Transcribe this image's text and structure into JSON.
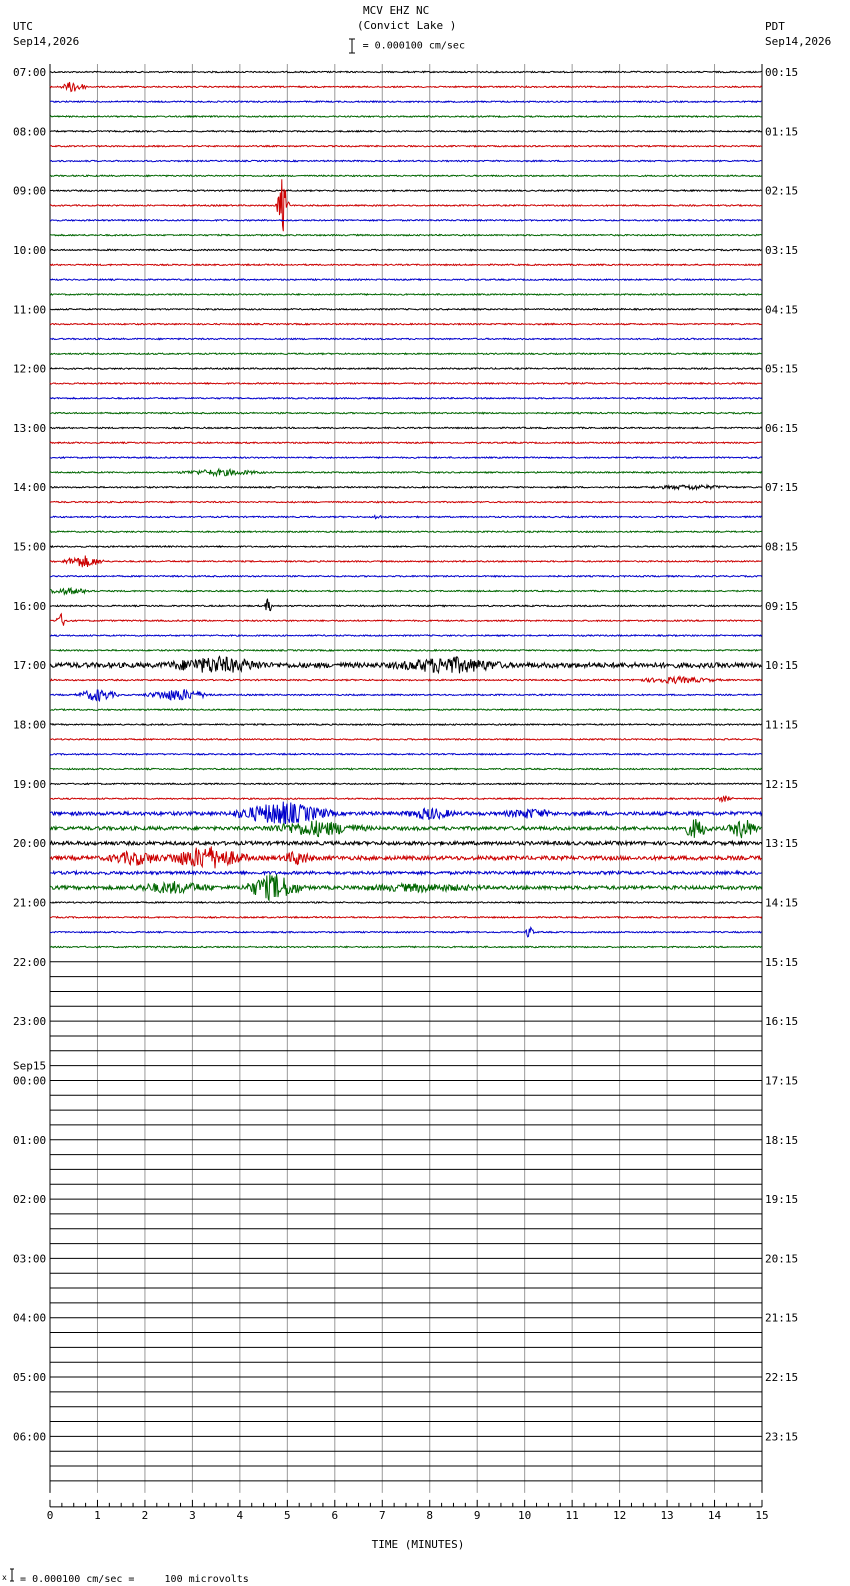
{
  "header": {
    "station": "MCV EHZ NC",
    "location": "(Convict Lake )",
    "scale_text": "= 0.000100 cm/sec",
    "left_tz": "UTC",
    "left_date": "Sep14,2026",
    "right_tz": "PDT",
    "right_date": "Sep14,2026"
  },
  "footer": {
    "scale_note": "= 0.000100 cm/sec =     100 microvolts"
  },
  "chart_data": {
    "type": "line",
    "title": "MCV EHZ NC (Convict Lake )",
    "xlabel": "TIME (MINUTES)",
    "ylabel": "",
    "xlim": [
      0,
      15
    ],
    "x_ticks": [
      "0",
      "1",
      "2",
      "3",
      "4",
      "5",
      "6",
      "7",
      "8",
      "9",
      "10",
      "11",
      "12",
      "13",
      "14",
      "15"
    ],
    "trace_minutes": 15,
    "total_traces": 96,
    "recorded_traces": 60,
    "trace_colors": [
      "#000000",
      "#cc0000",
      "#0000cc",
      "#006600"
    ],
    "utc_labels": [
      {
        "trace": 0,
        "label": "07:00"
      },
      {
        "trace": 4,
        "label": "08:00"
      },
      {
        "trace": 8,
        "label": "09:00"
      },
      {
        "trace": 12,
        "label": "10:00"
      },
      {
        "trace": 16,
        "label": "11:00"
      },
      {
        "trace": 20,
        "label": "12:00"
      },
      {
        "trace": 24,
        "label": "13:00"
      },
      {
        "trace": 28,
        "label": "14:00"
      },
      {
        "trace": 32,
        "label": "15:00"
      },
      {
        "trace": 36,
        "label": "16:00"
      },
      {
        "trace": 40,
        "label": "17:00"
      },
      {
        "trace": 44,
        "label": "18:00"
      },
      {
        "trace": 48,
        "label": "19:00"
      },
      {
        "trace": 52,
        "label": "20:00"
      },
      {
        "trace": 56,
        "label": "21:00"
      },
      {
        "trace": 60,
        "label": "22:00"
      },
      {
        "trace": 64,
        "label": "23:00"
      },
      {
        "trace": 68,
        "label": "00:00",
        "date": "Sep15"
      },
      {
        "trace": 72,
        "label": "01:00"
      },
      {
        "trace": 76,
        "label": "02:00"
      },
      {
        "trace": 80,
        "label": "03:00"
      },
      {
        "trace": 84,
        "label": "04:00"
      },
      {
        "trace": 88,
        "label": "05:00"
      },
      {
        "trace": 92,
        "label": "06:00"
      }
    ],
    "pdt_labels": [
      {
        "trace": 0,
        "label": "00:15"
      },
      {
        "trace": 4,
        "label": "01:15"
      },
      {
        "trace": 8,
        "label": "02:15"
      },
      {
        "trace": 12,
        "label": "03:15"
      },
      {
        "trace": 16,
        "label": "04:15"
      },
      {
        "trace": 20,
        "label": "05:15"
      },
      {
        "trace": 24,
        "label": "06:15"
      },
      {
        "trace": 28,
        "label": "07:15"
      },
      {
        "trace": 32,
        "label": "08:15"
      },
      {
        "trace": 36,
        "label": "09:15"
      },
      {
        "trace": 40,
        "label": "10:15"
      },
      {
        "trace": 44,
        "label": "11:15"
      },
      {
        "trace": 48,
        "label": "12:15"
      },
      {
        "trace": 52,
        "label": "13:15"
      },
      {
        "trace": 56,
        "label": "14:15"
      },
      {
        "trace": 60,
        "label": "15:15"
      },
      {
        "trace": 64,
        "label": "16:15"
      },
      {
        "trace": 68,
        "label": "17:15"
      },
      {
        "trace": 72,
        "label": "18:15"
      },
      {
        "trace": 76,
        "label": "19:15"
      },
      {
        "trace": 80,
        "label": "20:15"
      },
      {
        "trace": 84,
        "label": "21:15"
      },
      {
        "trace": 88,
        "label": "22:15"
      },
      {
        "trace": 92,
        "label": "23:15"
      }
    ],
    "events": [
      {
        "trace": 1,
        "minute": 0.5,
        "amp": 6,
        "width": 0.3
      },
      {
        "trace": 9,
        "minute": 4.9,
        "amp": 30,
        "width": 0.15
      },
      {
        "trace": 27,
        "minute": 3.6,
        "amp": 3,
        "width": 1.0
      },
      {
        "trace": 28,
        "minute": 13.5,
        "amp": 2,
        "width": 1.0
      },
      {
        "trace": 30,
        "minute": 6.9,
        "amp": 3,
        "width": 0.1
      },
      {
        "trace": 33,
        "minute": 0.7,
        "amp": 6,
        "width": 0.5
      },
      {
        "trace": 35,
        "minute": 0.4,
        "amp": 3,
        "width": 0.6
      },
      {
        "trace": 36,
        "minute": 4.6,
        "amp": 8,
        "width": 0.1
      },
      {
        "trace": 37,
        "minute": 0.25,
        "amp": 7,
        "width": 0.15
      },
      {
        "trace": 40,
        "minute": 3.5,
        "amp": 7,
        "width": 1.2
      },
      {
        "trace": 40,
        "minute": 8.4,
        "amp": 7,
        "width": 1.3
      },
      {
        "trace": 41,
        "minute": 13.2,
        "amp": 3,
        "width": 1.0
      },
      {
        "trace": 42,
        "minute": 1.0,
        "amp": 6,
        "width": 0.5
      },
      {
        "trace": 42,
        "minute": 2.7,
        "amp": 6,
        "width": 0.8
      },
      {
        "trace": 49,
        "minute": 14.2,
        "amp": 3,
        "width": 0.2
      },
      {
        "trace": 50,
        "minute": 4.9,
        "amp": 11,
        "width": 1.2
      },
      {
        "trace": 50,
        "minute": 8.0,
        "amp": 5,
        "width": 0.6
      },
      {
        "trace": 50,
        "minute": 10.1,
        "amp": 4,
        "width": 0.6
      },
      {
        "trace": 51,
        "minute": 5.6,
        "amp": 7,
        "width": 1.2
      },
      {
        "trace": 51,
        "minute": 13.6,
        "amp": 9,
        "width": 0.35
      },
      {
        "trace": 51,
        "minute": 14.6,
        "amp": 10,
        "width": 0.35
      },
      {
        "trace": 53,
        "minute": 3.3,
        "amp": 11,
        "width": 1.0
      },
      {
        "trace": 53,
        "minute": 1.8,
        "amp": 6,
        "width": 0.7
      },
      {
        "trace": 53,
        "minute": 5.2,
        "amp": 6,
        "width": 0.4
      },
      {
        "trace": 55,
        "minute": 4.7,
        "amp": 13,
        "width": 0.7
      },
      {
        "trace": 55,
        "minute": 2.6,
        "amp": 5,
        "width": 1.0
      },
      {
        "trace": 55,
        "minute": 7.8,
        "amp": 3,
        "width": 1.5
      },
      {
        "trace": 58,
        "minute": 10.1,
        "amp": 8,
        "width": 0.1
      }
    ],
    "noise": [
      {
        "trace": 40,
        "level": 2.5
      },
      {
        "trace": 50,
        "level": 1.8
      },
      {
        "trace": 51,
        "level": 1.8
      },
      {
        "trace": 52,
        "level": 1.8
      },
      {
        "trace": 53,
        "level": 2.0
      },
      {
        "trace": 54,
        "level": 1.5
      },
      {
        "trace": 55,
        "level": 1.8
      }
    ]
  }
}
